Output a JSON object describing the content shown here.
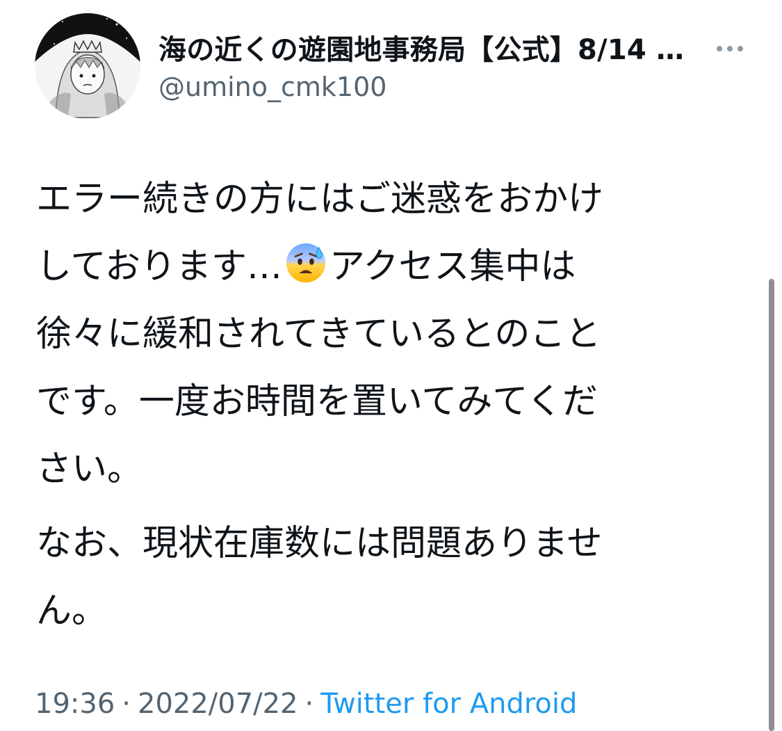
{
  "author": {
    "display_name": "海の近くの遊園地事務局【公式】8/14 …",
    "handle": "@umino_cmk100"
  },
  "tweet": {
    "para1_line1": "エラー続きの方にはご迷惑をおかけ",
    "para1_line2_pre": "しております…",
    "para1_line2_emoji": "anxious-face-with-sweat-emoji",
    "para1_line2_post": "アクセス集中は",
    "para1_line3": "徐々に緩和されてきているとのこと",
    "para1_line4": "です。一度お時間を置いてみてくだ",
    "para1_line5": "さい。",
    "para2_line1": "なお、現状在庫数には問題ありませ",
    "para2_line2": "ん。"
  },
  "meta": {
    "time": "19:36",
    "separator": "·",
    "date": "2022/07/22",
    "source": "Twitter for Android"
  },
  "colors": {
    "text": "#0f1419",
    "secondary": "#536471",
    "link": "#1d9bf0"
  },
  "icons": {
    "more": "more-horizontal-icon",
    "avatar": "avatar-image"
  }
}
